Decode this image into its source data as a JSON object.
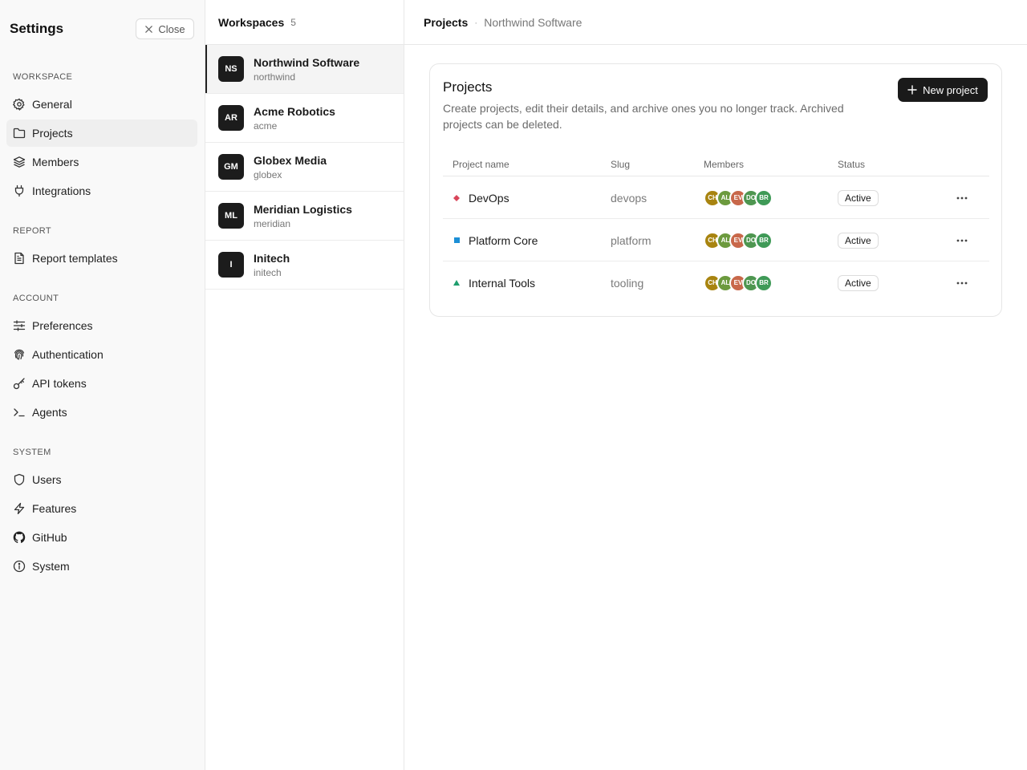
{
  "sidebar": {
    "title": "Settings",
    "close_label": "Close",
    "sections": [
      {
        "label": "WORKSPACE",
        "items": [
          {
            "label": "General",
            "icon": "gear-icon"
          },
          {
            "label": "Projects",
            "icon": "folder-icon",
            "active": true
          },
          {
            "label": "Members",
            "icon": "layers-icon"
          },
          {
            "label": "Integrations",
            "icon": "plug-icon"
          }
        ]
      },
      {
        "label": "REPORT",
        "items": [
          {
            "label": "Report templates",
            "icon": "document-icon"
          }
        ]
      },
      {
        "label": "ACCOUNT",
        "items": [
          {
            "label": "Preferences",
            "icon": "sliders-icon"
          },
          {
            "label": "Authentication",
            "icon": "fingerprint-icon"
          },
          {
            "label": "API tokens",
            "icon": "key-icon"
          },
          {
            "label": "Agents",
            "icon": "terminal-icon"
          }
        ]
      },
      {
        "label": "SYSTEM",
        "items": [
          {
            "label": "Users",
            "icon": "shield-icon"
          },
          {
            "label": "Features",
            "icon": "zap-icon"
          },
          {
            "label": "GitHub",
            "icon": "github-icon"
          },
          {
            "label": "System",
            "icon": "info-icon"
          }
        ]
      }
    ]
  },
  "workspaces": {
    "title": "Workspaces",
    "count": "5",
    "items": [
      {
        "initials": "NS",
        "name": "Northwind Software",
        "slug": "northwind",
        "active": true
      },
      {
        "initials": "AR",
        "name": "Acme Robotics",
        "slug": "acme"
      },
      {
        "initials": "GM",
        "name": "Globex Media",
        "slug": "globex"
      },
      {
        "initials": "ML",
        "name": "Meridian Logistics",
        "slug": "meridian"
      },
      {
        "initials": "I",
        "name": "Initech",
        "slug": "initech"
      }
    ]
  },
  "main": {
    "breadcrumb": {
      "current": "Projects",
      "separator": "·",
      "parent": "Northwind Software"
    },
    "card": {
      "title": "Projects",
      "description": "Create projects, edit their details, and archive ones you no longer track. Archived projects can be deleted.",
      "new_button_label": "New project"
    },
    "table": {
      "columns": [
        "Project name",
        "Slug",
        "Members",
        "Status"
      ],
      "rows": [
        {
          "name": "DevOps",
          "slug": "devops",
          "icon": "diamond-icon",
          "icon_color": "#d9455a",
          "members": [
            "CH",
            "AL",
            "EV",
            "DO",
            "BR"
          ],
          "status": "Active"
        },
        {
          "name": "Platform Core",
          "slug": "platform",
          "icon": "square-icon",
          "icon_color": "#1c8fd6",
          "members": [
            "CH",
            "AL",
            "EV",
            "DO",
            "BR"
          ],
          "status": "Active"
        },
        {
          "name": "Internal Tools",
          "slug": "tooling",
          "icon": "triangle-icon",
          "icon_color": "#1f9e6e",
          "members": [
            "CH",
            "AL",
            "EV",
            "DO",
            "BR"
          ],
          "status": "Active"
        }
      ]
    }
  },
  "colors": {
    "member_avatars": [
      "#a88410",
      "#6c9a3e",
      "#c8684a",
      "#4e9650",
      "#3f9a57"
    ],
    "primary_button": "#1a1a1a"
  }
}
